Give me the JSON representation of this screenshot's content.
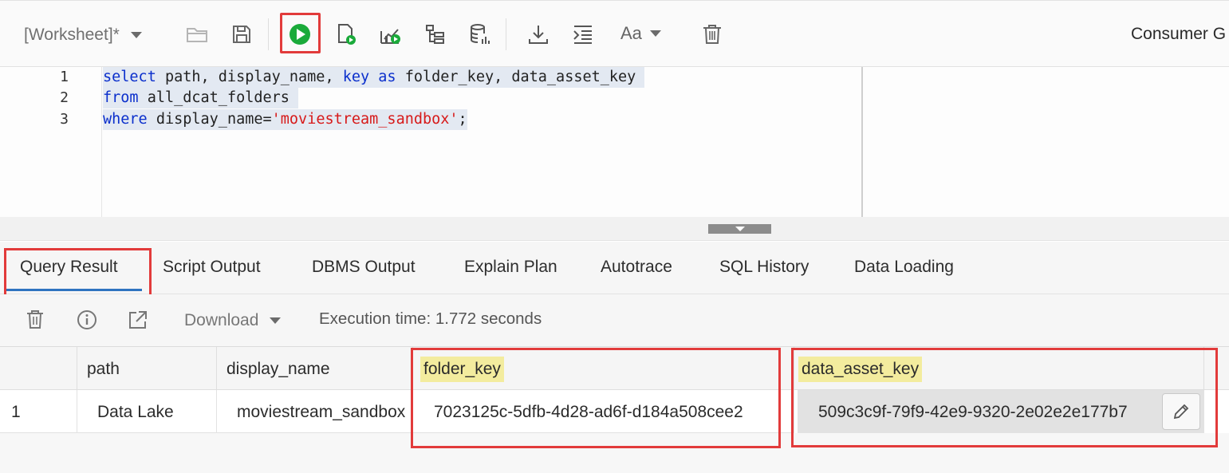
{
  "toolbar": {
    "worksheet_label": "[Worksheet]*",
    "connection_label": "Consumer G",
    "font_label": "Aa",
    "icons": [
      "folder-icon",
      "save-icon",
      "run-statement-icon",
      "run-script-icon",
      "explain-plan-icon",
      "autotrace-icon",
      "database-icon",
      "download-icon",
      "format-icon",
      "font-icon",
      "trash-icon"
    ],
    "accent_color": "#1aaa3a",
    "highlight_color": "#e23b3b"
  },
  "editor": {
    "lines": [
      {
        "number": "1",
        "text": "select path, display_name, key as folder_key, data_asset_key"
      },
      {
        "number": "2",
        "text": "from all_dcat_folders"
      },
      {
        "number": "3",
        "text": "where display_name='moviestream_sandbox';"
      }
    ],
    "tokens": {
      "l1_kw1": "select",
      "l1_t1": " path, display_name, ",
      "l1_kw2": "key",
      "l1_t2": " ",
      "l1_kw3": "as",
      "l1_t3": " folder_key, data_asset_key",
      "l2_kw1": "from",
      "l2_t1": " all_dcat_folders",
      "l3_kw1": "where",
      "l3_t1": " display_name=",
      "l3_str": "'moviestream_sandbox'",
      "l3_t2": ";"
    }
  },
  "tabs": {
    "items": [
      "Query Result",
      "Script Output",
      "DBMS Output",
      "Explain Plan",
      "Autotrace",
      "SQL History",
      "Data Loading"
    ],
    "active": "Query Result"
  },
  "results": {
    "download_label": "Download",
    "execution_time": "Execution time: 1.772 seconds",
    "columns": [
      "path",
      "display_name",
      "folder_key",
      "data_asset_key"
    ],
    "rows": [
      {
        "row_number": "1",
        "path": "Data Lake",
        "display_name": "moviestream_sandbox",
        "folder_key": "7023125c-5dfb-4d28-ad6f-d184a508cee2",
        "data_asset_key": "509c3c9f-79f9-42e9-9320-2e02e2e177b7"
      }
    ]
  }
}
